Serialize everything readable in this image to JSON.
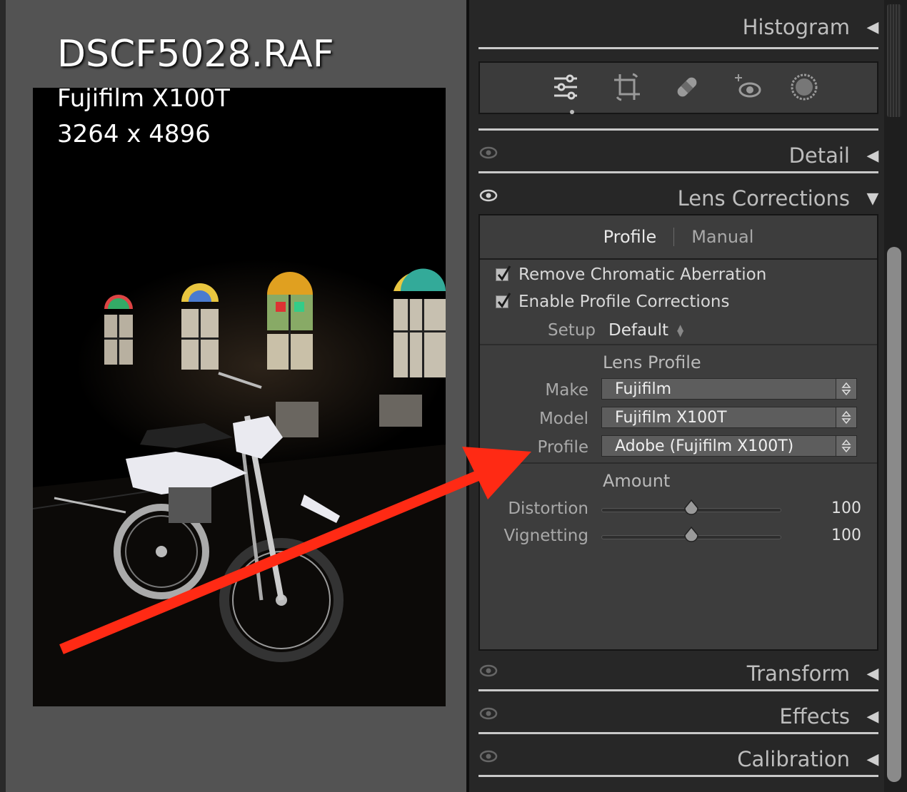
{
  "photo_info": {
    "filename": "DSCF5028.RAF",
    "camera": "Fujifilm X100T",
    "dimensions": "3264 x 4896"
  },
  "panel": {
    "histogram": {
      "label": "Histogram"
    },
    "tools": [
      "sliders-icon",
      "crop-icon",
      "healing-icon",
      "redeye-icon",
      "mask-icon"
    ],
    "detail": {
      "label": "Detail"
    },
    "lens_corrections": {
      "label": "Lens Corrections",
      "tabs": {
        "profile": "Profile",
        "manual": "Manual"
      },
      "remove_ca": {
        "label": "Remove Chromatic Aberration",
        "checked": true
      },
      "enable_profile": {
        "label": "Enable Profile Corrections",
        "checked": true
      },
      "setup": {
        "label": "Setup",
        "value": "Default"
      },
      "lens_profile": {
        "title": "Lens Profile",
        "make": {
          "label": "Make",
          "value": "Fujifilm"
        },
        "model": {
          "label": "Model",
          "value": "Fujifilm X100T"
        },
        "profile": {
          "label": "Profile",
          "value": "Adobe (Fujifilm X100T)"
        }
      },
      "amount": {
        "title": "Amount",
        "distortion": {
          "label": "Distortion",
          "value": "100",
          "level": 0.5
        },
        "vignetting": {
          "label": "Vignetting",
          "value": "100",
          "level": 0.5
        }
      }
    },
    "transform": {
      "label": "Transform"
    },
    "effects": {
      "label": "Effects"
    },
    "calibration": {
      "label": "Calibration"
    }
  },
  "colors": {
    "annotation_arrow": "#ff2a14",
    "panel_bg": "#272727",
    "viewer_bg": "#535353"
  }
}
